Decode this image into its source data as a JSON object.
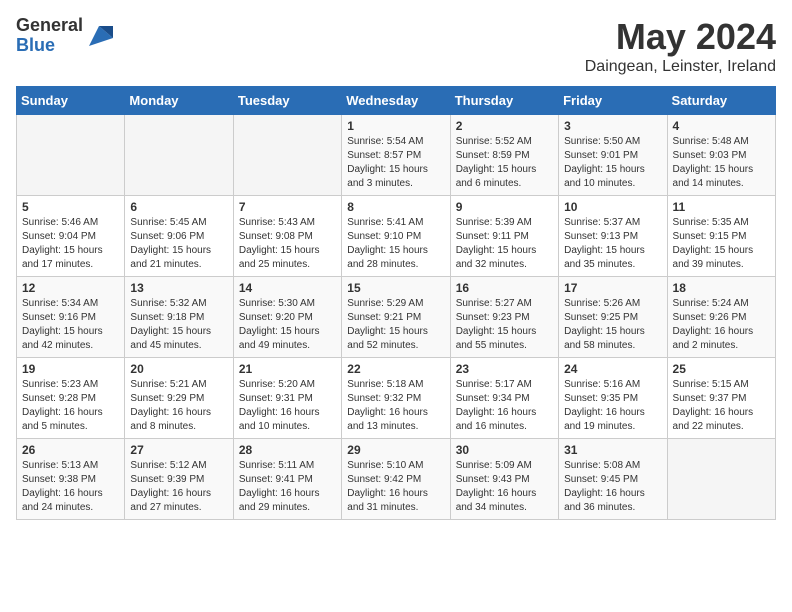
{
  "header": {
    "logo_general": "General",
    "logo_blue": "Blue",
    "month_year": "May 2024",
    "location": "Daingean, Leinster, Ireland"
  },
  "weekdays": [
    "Sunday",
    "Monday",
    "Tuesday",
    "Wednesday",
    "Thursday",
    "Friday",
    "Saturday"
  ],
  "weeks": [
    [
      {
        "day": "",
        "info": ""
      },
      {
        "day": "",
        "info": ""
      },
      {
        "day": "",
        "info": ""
      },
      {
        "day": "1",
        "info": "Sunrise: 5:54 AM\nSunset: 8:57 PM\nDaylight: 15 hours\nand 3 minutes."
      },
      {
        "day": "2",
        "info": "Sunrise: 5:52 AM\nSunset: 8:59 PM\nDaylight: 15 hours\nand 6 minutes."
      },
      {
        "day": "3",
        "info": "Sunrise: 5:50 AM\nSunset: 9:01 PM\nDaylight: 15 hours\nand 10 minutes."
      },
      {
        "day": "4",
        "info": "Sunrise: 5:48 AM\nSunset: 9:03 PM\nDaylight: 15 hours\nand 14 minutes."
      }
    ],
    [
      {
        "day": "5",
        "info": "Sunrise: 5:46 AM\nSunset: 9:04 PM\nDaylight: 15 hours\nand 17 minutes."
      },
      {
        "day": "6",
        "info": "Sunrise: 5:45 AM\nSunset: 9:06 PM\nDaylight: 15 hours\nand 21 minutes."
      },
      {
        "day": "7",
        "info": "Sunrise: 5:43 AM\nSunset: 9:08 PM\nDaylight: 15 hours\nand 25 minutes."
      },
      {
        "day": "8",
        "info": "Sunrise: 5:41 AM\nSunset: 9:10 PM\nDaylight: 15 hours\nand 28 minutes."
      },
      {
        "day": "9",
        "info": "Sunrise: 5:39 AM\nSunset: 9:11 PM\nDaylight: 15 hours\nand 32 minutes."
      },
      {
        "day": "10",
        "info": "Sunrise: 5:37 AM\nSunset: 9:13 PM\nDaylight: 15 hours\nand 35 minutes."
      },
      {
        "day": "11",
        "info": "Sunrise: 5:35 AM\nSunset: 9:15 PM\nDaylight: 15 hours\nand 39 minutes."
      }
    ],
    [
      {
        "day": "12",
        "info": "Sunrise: 5:34 AM\nSunset: 9:16 PM\nDaylight: 15 hours\nand 42 minutes."
      },
      {
        "day": "13",
        "info": "Sunrise: 5:32 AM\nSunset: 9:18 PM\nDaylight: 15 hours\nand 45 minutes."
      },
      {
        "day": "14",
        "info": "Sunrise: 5:30 AM\nSunset: 9:20 PM\nDaylight: 15 hours\nand 49 minutes."
      },
      {
        "day": "15",
        "info": "Sunrise: 5:29 AM\nSunset: 9:21 PM\nDaylight: 15 hours\nand 52 minutes."
      },
      {
        "day": "16",
        "info": "Sunrise: 5:27 AM\nSunset: 9:23 PM\nDaylight: 15 hours\nand 55 minutes."
      },
      {
        "day": "17",
        "info": "Sunrise: 5:26 AM\nSunset: 9:25 PM\nDaylight: 15 hours\nand 58 minutes."
      },
      {
        "day": "18",
        "info": "Sunrise: 5:24 AM\nSunset: 9:26 PM\nDaylight: 16 hours\nand 2 minutes."
      }
    ],
    [
      {
        "day": "19",
        "info": "Sunrise: 5:23 AM\nSunset: 9:28 PM\nDaylight: 16 hours\nand 5 minutes."
      },
      {
        "day": "20",
        "info": "Sunrise: 5:21 AM\nSunset: 9:29 PM\nDaylight: 16 hours\nand 8 minutes."
      },
      {
        "day": "21",
        "info": "Sunrise: 5:20 AM\nSunset: 9:31 PM\nDaylight: 16 hours\nand 10 minutes."
      },
      {
        "day": "22",
        "info": "Sunrise: 5:18 AM\nSunset: 9:32 PM\nDaylight: 16 hours\nand 13 minutes."
      },
      {
        "day": "23",
        "info": "Sunrise: 5:17 AM\nSunset: 9:34 PM\nDaylight: 16 hours\nand 16 minutes."
      },
      {
        "day": "24",
        "info": "Sunrise: 5:16 AM\nSunset: 9:35 PM\nDaylight: 16 hours\nand 19 minutes."
      },
      {
        "day": "25",
        "info": "Sunrise: 5:15 AM\nSunset: 9:37 PM\nDaylight: 16 hours\nand 22 minutes."
      }
    ],
    [
      {
        "day": "26",
        "info": "Sunrise: 5:13 AM\nSunset: 9:38 PM\nDaylight: 16 hours\nand 24 minutes."
      },
      {
        "day": "27",
        "info": "Sunrise: 5:12 AM\nSunset: 9:39 PM\nDaylight: 16 hours\nand 27 minutes."
      },
      {
        "day": "28",
        "info": "Sunrise: 5:11 AM\nSunset: 9:41 PM\nDaylight: 16 hours\nand 29 minutes."
      },
      {
        "day": "29",
        "info": "Sunrise: 5:10 AM\nSunset: 9:42 PM\nDaylight: 16 hours\nand 31 minutes."
      },
      {
        "day": "30",
        "info": "Sunrise: 5:09 AM\nSunset: 9:43 PM\nDaylight: 16 hours\nand 34 minutes."
      },
      {
        "day": "31",
        "info": "Sunrise: 5:08 AM\nSunset: 9:45 PM\nDaylight: 16 hours\nand 36 minutes."
      },
      {
        "day": "",
        "info": ""
      }
    ]
  ]
}
